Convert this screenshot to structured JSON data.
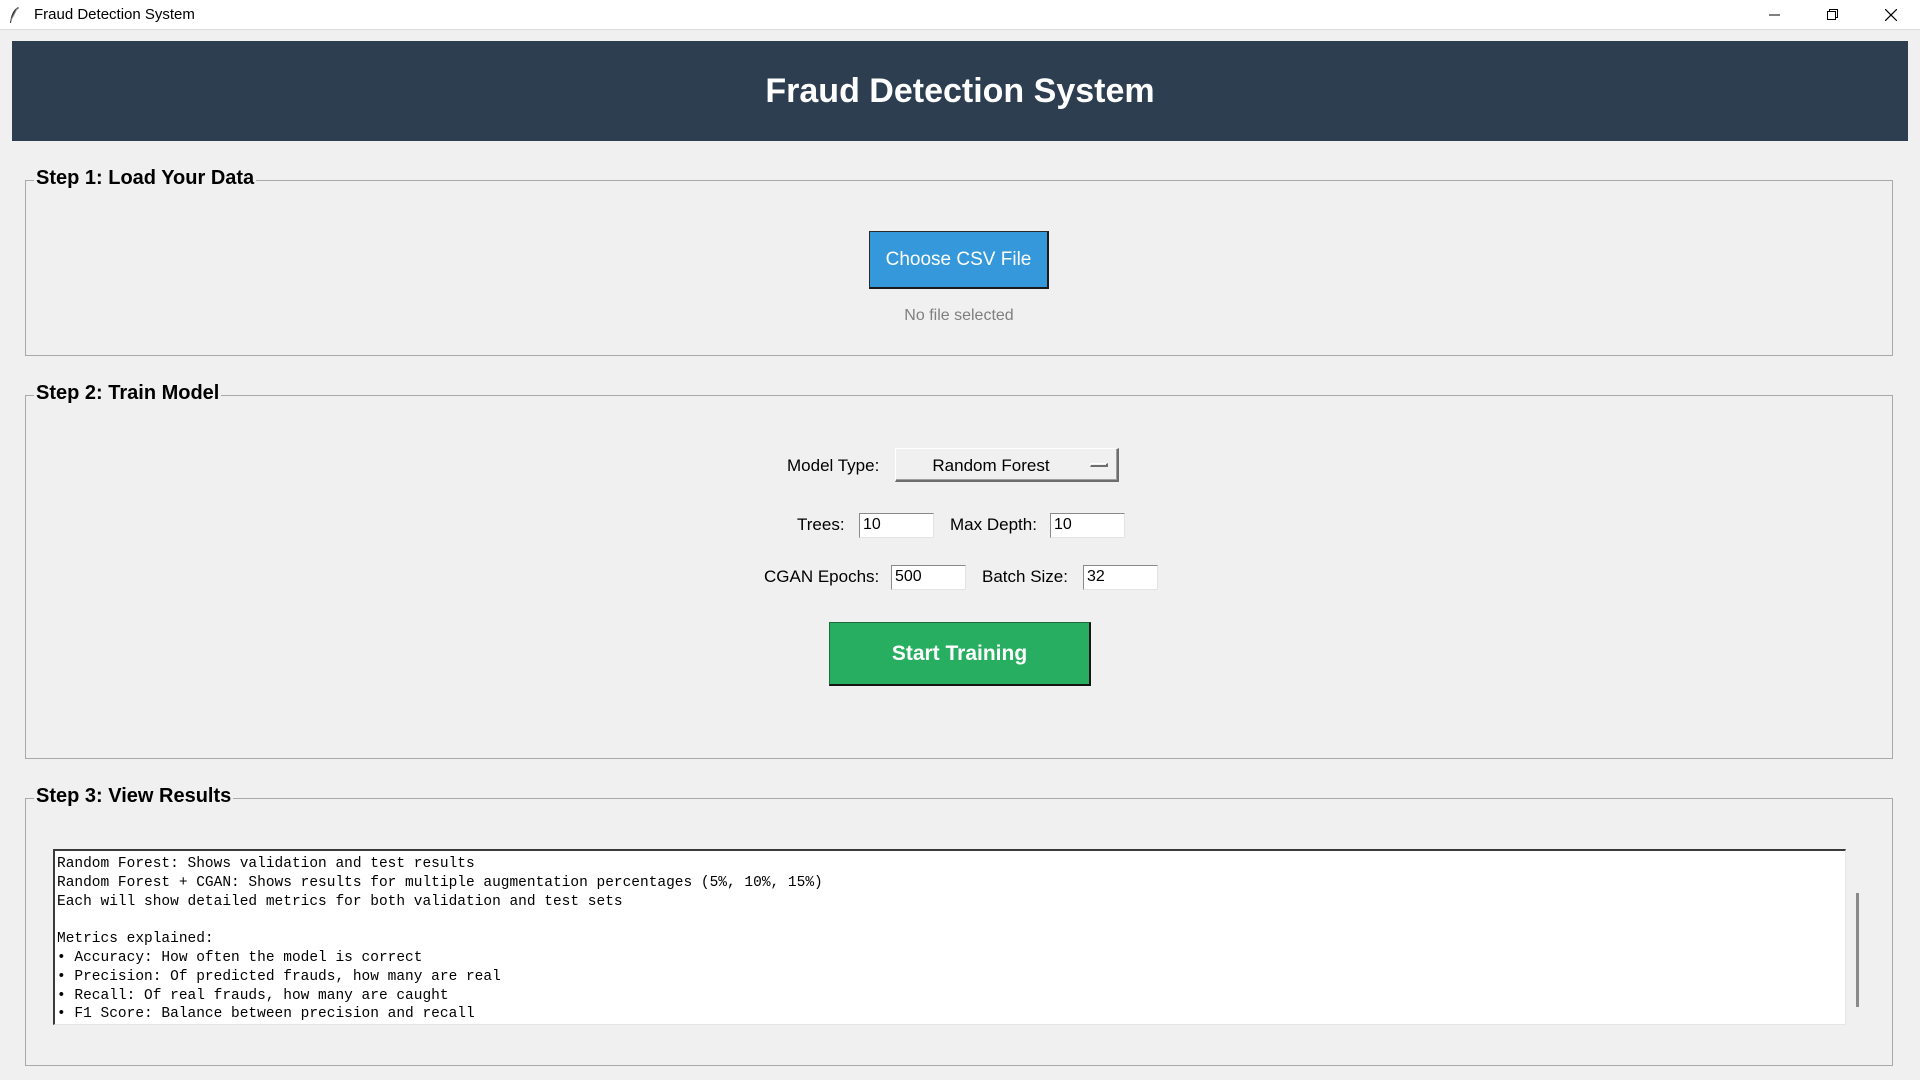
{
  "window": {
    "title": "Fraud Detection System"
  },
  "header": {
    "title": "Fraud Detection System",
    "background": "#2c3e50"
  },
  "step1": {
    "label": "Step 1: Load Your Data",
    "choose_button": "Choose CSV File",
    "file_status": "No file selected",
    "button_color": "#3498db"
  },
  "step2": {
    "label": "Step 2: Train Model",
    "model_type_label": "Model Type:",
    "model_type_value": "Random Forest",
    "trees_label": "Trees:",
    "trees_value": "10",
    "max_depth_label": "Max Depth:",
    "max_depth_value": "10",
    "cgan_epochs_label": "CGAN Epochs:",
    "cgan_epochs_value": "500",
    "batch_size_label": "Batch Size:",
    "batch_size_value": "32",
    "train_button": "Start Training",
    "button_color": "#27ae60"
  },
  "step3": {
    "label": "Step 3: View Results",
    "lines": [
      "Random Forest: Shows validation and test results",
      "Random Forest + CGAN: Shows results for multiple augmentation percentages (5%, 10%, 15%)",
      "Each will show detailed metrics for both validation and test sets",
      "",
      "Metrics explained:",
      "• Accuracy: How often the model is correct",
      "• Precision: Of predicted frauds, how many are real",
      "• Recall: Of real frauds, how many are caught",
      "• F1 Score: Balance between precision and recall"
    ]
  }
}
